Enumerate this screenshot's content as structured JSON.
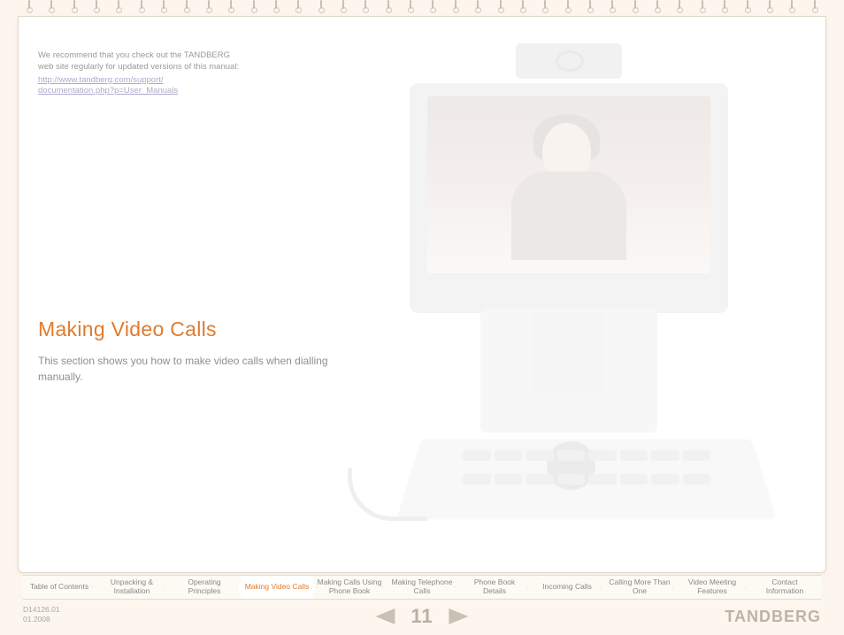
{
  "recommend": {
    "text": "We recommend that you check out the TANDBERG web site regularly for updated versions of this manual:",
    "link_line1": "http://www.tandberg.com/support/",
    "link_line2": "documentation.php?p=User_Manuals"
  },
  "section": {
    "title": "Making Video Calls",
    "description": "This section shows you how to make video calls when dialling manually."
  },
  "nav": {
    "tabs": [
      "Table of Contents",
      "Unpacking & Installation",
      "Operating Principles",
      "Making Video Calls",
      "Making Calls Using Phone Book",
      "Making Telephone Calls",
      "Phone Book Details",
      "Incoming Calls",
      "Calling More Than One",
      "Video Meeting Features",
      "Contact Information"
    ],
    "active_index": 3
  },
  "footer": {
    "docnum_line1": "D14126.01",
    "docnum_line2": "01.2008",
    "page_number": "11",
    "brand": "TANDBERG"
  }
}
